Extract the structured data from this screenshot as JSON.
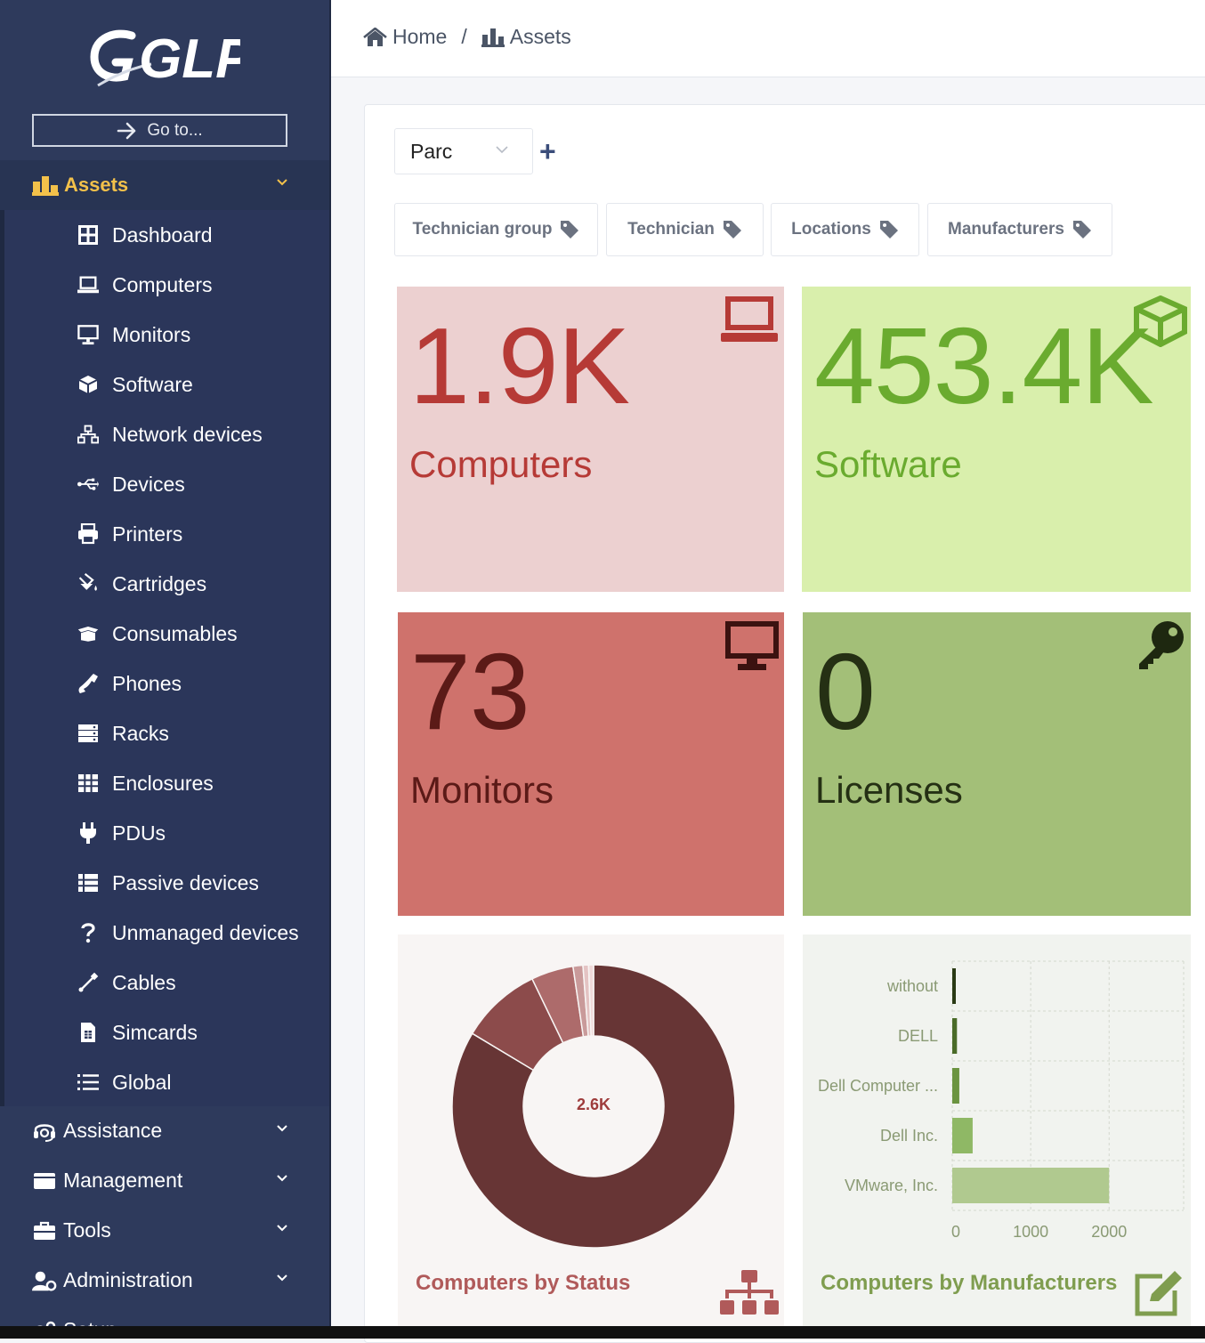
{
  "app": {
    "name": "GLPI"
  },
  "sidebar": {
    "goto_label": "Go to...",
    "active_section": {
      "label": "Assets",
      "icon": "assets-icon",
      "color": "#f3c14a"
    },
    "items": [
      {
        "label": "Dashboard",
        "icon": "dashboard-icon"
      },
      {
        "label": "Computers",
        "icon": "laptop-icon"
      },
      {
        "label": "Monitors",
        "icon": "monitor-icon"
      },
      {
        "label": "Software",
        "icon": "cube-icon"
      },
      {
        "label": "Network devices",
        "icon": "network-icon"
      },
      {
        "label": "Devices",
        "icon": "usb-icon"
      },
      {
        "label": "Printers",
        "icon": "printer-icon"
      },
      {
        "label": "Cartridges",
        "icon": "fill-drip-icon"
      },
      {
        "label": "Consumables",
        "icon": "box-open-icon"
      },
      {
        "label": "Phones",
        "icon": "phone-icon"
      },
      {
        "label": "Racks",
        "icon": "server-icon"
      },
      {
        "label": "Enclosures",
        "icon": "grid-icon"
      },
      {
        "label": "PDUs",
        "icon": "plug-icon"
      },
      {
        "label": "Passive devices",
        "icon": "list-alt-icon"
      },
      {
        "label": "Unmanaged devices",
        "icon": "question-icon"
      },
      {
        "label": "Cables",
        "icon": "cable-icon"
      },
      {
        "label": "Simcards",
        "icon": "simcard-icon"
      },
      {
        "label": "Global",
        "icon": "list-icon"
      }
    ],
    "sections": [
      {
        "label": "Assistance",
        "icon": "headset-icon"
      },
      {
        "label": "Management",
        "icon": "wallet-icon"
      },
      {
        "label": "Tools",
        "icon": "toolbox-icon"
      },
      {
        "label": "Administration",
        "icon": "user-cog-icon"
      },
      {
        "label": "Setup",
        "icon": "cogs-icon"
      }
    ]
  },
  "breadcrumb": {
    "home": "Home",
    "current": "Assets"
  },
  "dashboard": {
    "selected": "Parc",
    "add_label": "+",
    "filters": [
      "Technician group",
      "Technician",
      "Locations",
      "Manufacturers"
    ]
  },
  "tiles": [
    {
      "value": "1.9K",
      "label": "Computers",
      "icon": "laptop-icon",
      "bg": "#ecd0d0",
      "fg": "#b63a36"
    },
    {
      "value": "453.4K",
      "label": "Software",
      "icon": "cube-icon",
      "bg": "#d9efac",
      "fg": "#6aab2f"
    },
    {
      "value": "73",
      "label": "Monitors",
      "icon": "monitor-icon",
      "bg": "#cf726c",
      "fg": "#5b1a17"
    },
    {
      "value": "0",
      "label": "Licenses",
      "icon": "key-icon",
      "bg": "#a3bf78",
      "fg": "#253014"
    }
  ],
  "chart_data": [
    {
      "type": "pie",
      "title": "Computers by Status",
      "center_label": "2.6K",
      "values": [
        2080,
        230,
        120,
        28,
        16,
        14
      ],
      "colors": [
        "#673535",
        "#8c4b4b",
        "#ad6b6b",
        "#c99a9a",
        "#e4c3c3",
        "#efd9d9"
      ]
    },
    {
      "type": "bar",
      "orientation": "horizontal",
      "title": "Computers by Manufacturers",
      "categories": [
        "without",
        "DELL",
        "Dell Computer ...",
        "Dell Inc.",
        "VMware, Inc."
      ],
      "values": [
        30,
        60,
        90,
        260,
        2000
      ],
      "colors": [
        "#2a3a14",
        "#4a6b28",
        "#6b9440",
        "#8fb865",
        "#b0c98f"
      ],
      "xlim": [
        0,
        2950
      ],
      "xticks": [
        "0",
        "1000",
        "2000"
      ],
      "grid": true
    }
  ]
}
